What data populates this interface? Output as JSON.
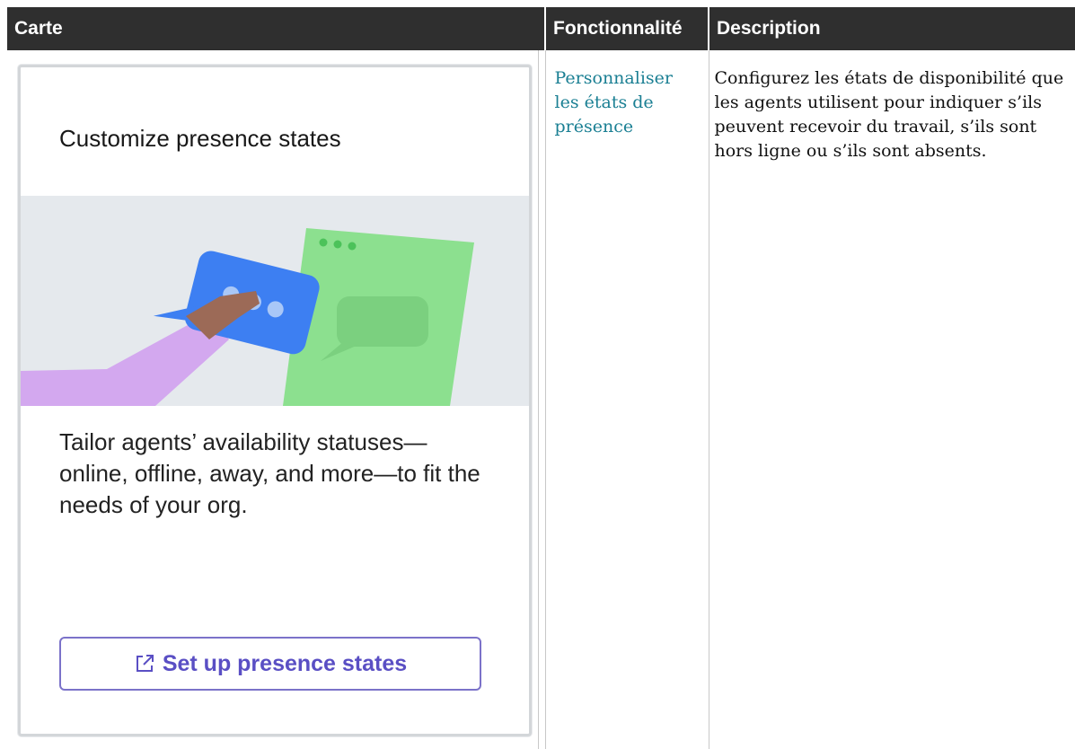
{
  "table": {
    "headers": {
      "card": "Carte",
      "feature": "Fonctionnalité",
      "description": "Description"
    },
    "rows": [
      {
        "card": {
          "title": "Customize presence states",
          "body": "Tailor agents’ availability statuses—online, offline, away, and more—to fit the needs of your org.",
          "button_label": "Set up presence states",
          "button_icon": "external-link-icon"
        },
        "feature_link": "Personnaliser les états de présence",
        "description": "Configurez les états de disponibilité que les agents utilisent pour indiquer s’ils peuvent recevoir du travail, s’ils sont hors ligne ou s’ils sont absents."
      }
    ]
  },
  "colors": {
    "header_bg": "#2f2f2f",
    "header_text": "#ffffff",
    "link": "#1a7f93",
    "button_border": "#7b72c9",
    "button_text": "#5a4fc4",
    "illustration_bg": "#e5e9ed",
    "document_green": "#8ce08f",
    "bubble_blue": "#3d7ff2",
    "sleeve_purple": "#d3a8ef",
    "hand_brown": "#9c6a57"
  }
}
